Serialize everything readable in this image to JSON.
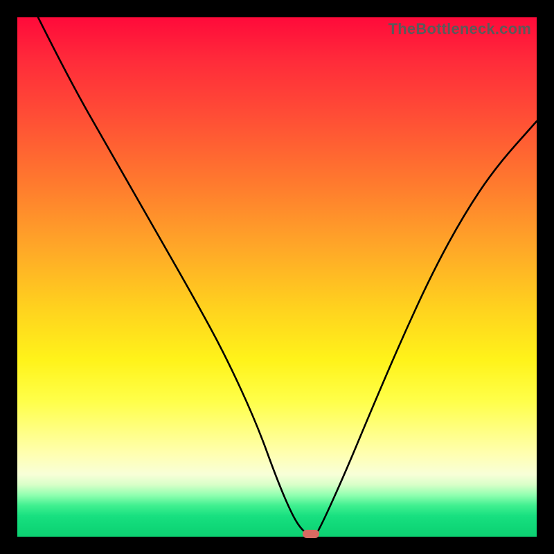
{
  "watermark": "TheBottleneck.com",
  "chart_data": {
    "type": "line",
    "title": "",
    "xlabel": "",
    "ylabel": "",
    "xlim": [
      0,
      100
    ],
    "ylim": [
      0,
      100
    ],
    "grid": false,
    "series": [
      {
        "name": "curve",
        "x": [
          4,
          10,
          18,
          26,
          34,
          40,
          46,
          50,
          53,
          55,
          57,
          58,
          63,
          68,
          74,
          80,
          86,
          92,
          100
        ],
        "values": [
          100,
          88,
          74,
          60,
          46,
          35,
          22,
          11,
          4,
          1,
          0,
          1,
          12,
          24,
          38,
          51,
          62,
          71,
          80
        ]
      }
    ],
    "marker": {
      "x": 56.5,
      "y": 0.5,
      "w": 3.2,
      "h": 1.6
    },
    "colors": {
      "curve": "#000000",
      "marker": "#d86a62",
      "gradient_top": "#ff0a3a",
      "gradient_bottom": "#0cd072"
    }
  }
}
